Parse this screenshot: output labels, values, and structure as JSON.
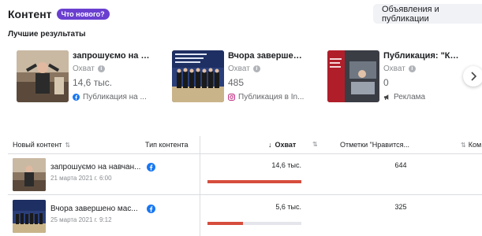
{
  "header": {
    "title": "Контент",
    "badge": "Что нового?",
    "dropdown_label": "Объявления и публикации"
  },
  "best_results": {
    "title": "Лучшие результаты",
    "cards": [
      {
        "title": "запрошуємо на на...",
        "metric": "Охват",
        "value": "14,6 тыс.",
        "type": "Публикация на ...",
        "type_icon": "facebook-icon"
      },
      {
        "title": "Вчора завершено ...",
        "metric": "Охват",
        "value": "485",
        "type": "Публикация в In...",
        "type_icon": "instagram-icon"
      },
      {
        "title": "Публикация: \"Київ...",
        "metric": "Охват",
        "value": "0",
        "type": "Реклама",
        "type_icon": "megaphone-icon"
      }
    ]
  },
  "table": {
    "columns": {
      "content": "Новый контент",
      "type": "Тип контента",
      "reach": "Охват",
      "likes": "Отметки \"Нравится...",
      "comments": "Ком"
    },
    "rows": [
      {
        "title": "запрошуємо на навчан...",
        "date": "21 марта 2021 г. 6:00",
        "reach": "14,6 тыс.",
        "reach_fraction": 1.0,
        "likes": "644"
      },
      {
        "title": "Вчора завершено мас...",
        "date": "25 марта 2021 г. 9:12",
        "reach": "5,6 тыс.",
        "reach_fraction": 0.38,
        "likes": "325"
      }
    ]
  },
  "colors": {
    "badge": "#6a3fd0",
    "bar": "#d64d3d",
    "facebook": "#1877f2",
    "instagram": "#c13584"
  }
}
